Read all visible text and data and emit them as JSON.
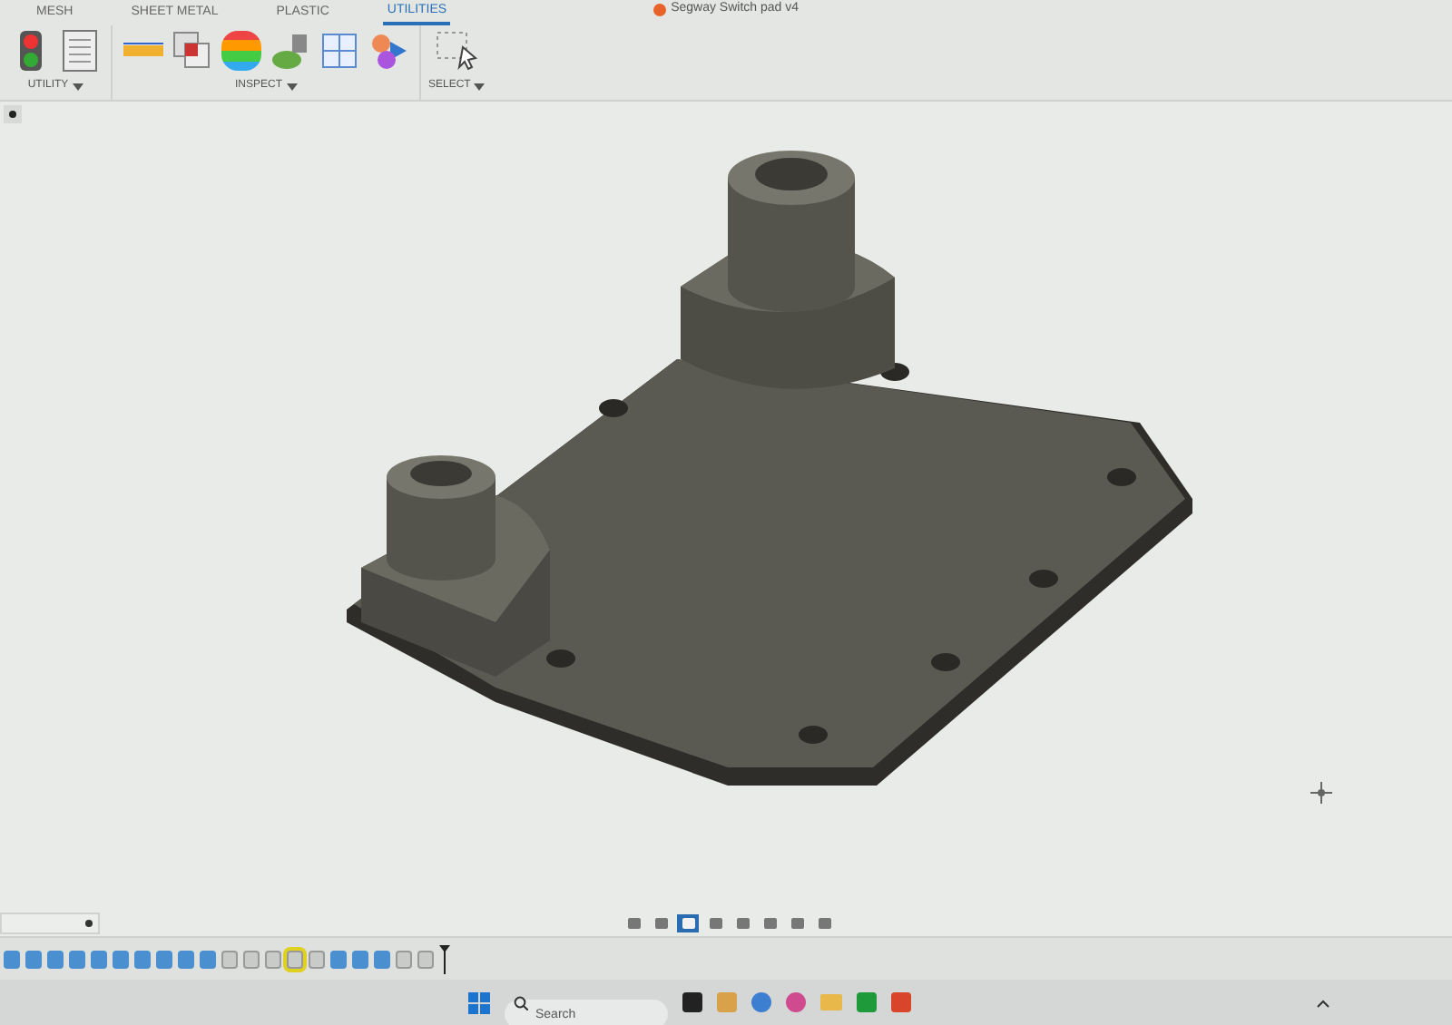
{
  "title": "Segway Switch pad v4",
  "tabs": [
    {
      "label": "MESH",
      "selected": false
    },
    {
      "label": "SHEET METAL",
      "selected": false
    },
    {
      "label": "PLASTIC",
      "selected": false
    },
    {
      "label": "UTILITIES",
      "selected": true
    }
  ],
  "groups": [
    {
      "label": "UTILITY",
      "tools": [
        {
          "kind": "stoplight"
        },
        {
          "kind": "table"
        }
      ]
    },
    {
      "label": "INSPECT",
      "tools": [
        {
          "kind": "measure"
        },
        {
          "kind": "interference"
        },
        {
          "kind": "curvature"
        },
        {
          "kind": "accessibility"
        },
        {
          "kind": "section"
        },
        {
          "kind": "components"
        }
      ]
    },
    {
      "label": "SELECT",
      "tools": [
        {
          "kind": "select"
        }
      ]
    }
  ],
  "timeline": [
    {
      "kind": "body",
      "selected": false
    },
    {
      "kind": "body",
      "selected": false
    },
    {
      "kind": "body",
      "selected": false
    },
    {
      "kind": "body",
      "selected": false
    },
    {
      "kind": "body",
      "selected": false
    },
    {
      "kind": "body",
      "selected": false
    },
    {
      "kind": "body",
      "selected": false
    },
    {
      "kind": "body",
      "selected": false
    },
    {
      "kind": "body",
      "selected": false
    },
    {
      "kind": "body",
      "selected": false
    },
    {
      "kind": "sketch",
      "selected": false
    },
    {
      "kind": "sketch",
      "selected": false
    },
    {
      "kind": "sketch",
      "selected": false
    },
    {
      "kind": "sketch",
      "selected": true
    },
    {
      "kind": "sketch",
      "selected": false
    },
    {
      "kind": "body",
      "selected": false
    },
    {
      "kind": "body",
      "selected": false
    },
    {
      "kind": "body",
      "selected": false
    },
    {
      "kind": "sketch",
      "selected": false
    },
    {
      "kind": "sketch",
      "selected": false
    }
  ],
  "nav_tools": [
    {
      "selected": false
    },
    {
      "selected": false
    },
    {
      "selected": true
    },
    {
      "selected": false
    },
    {
      "selected": false
    },
    {
      "selected": false
    },
    {
      "selected": false
    },
    {
      "selected": false
    }
  ],
  "taskbar": {
    "search": {
      "placeholder": "Search"
    }
  }
}
